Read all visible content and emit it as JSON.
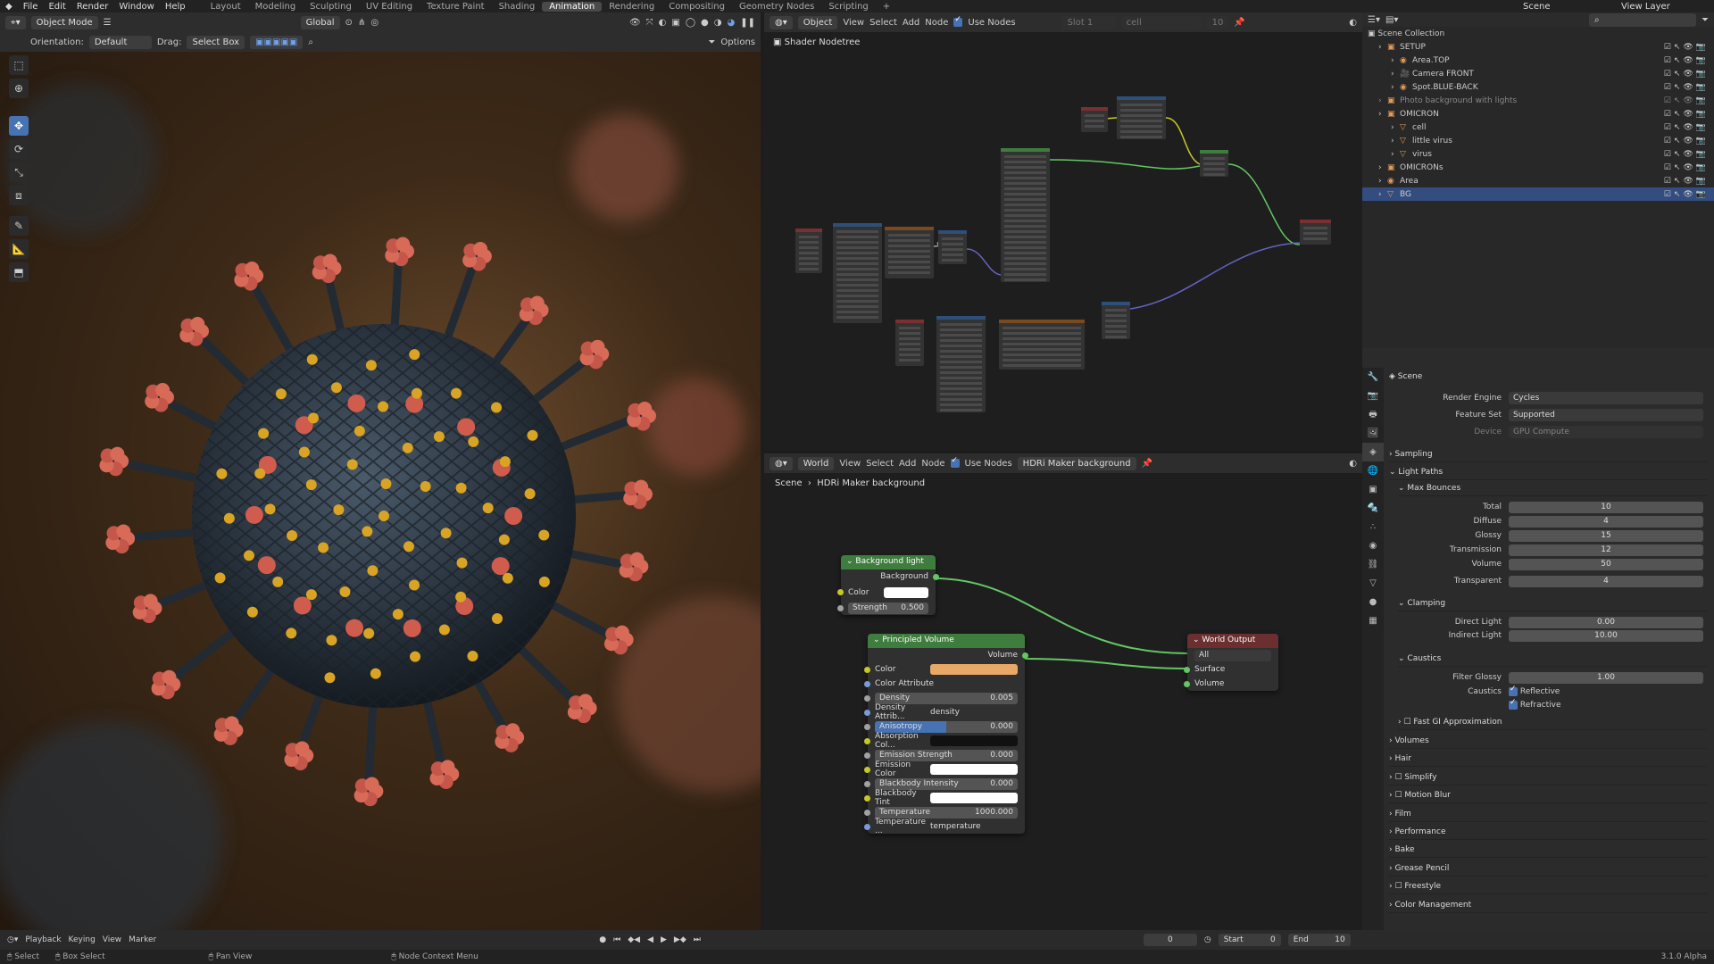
{
  "topbar": {
    "menus": [
      "File",
      "Edit",
      "Render",
      "Window",
      "Help"
    ],
    "workspaces": [
      "Layout",
      "Modeling",
      "Sculpting",
      "UV Editing",
      "Texture Paint",
      "Shading",
      "Animation",
      "Rendering",
      "Compositing",
      "Geometry Nodes",
      "Scripting"
    ],
    "active_workspace": "Animation",
    "scene": "Scene",
    "view_layer": "View Layer"
  },
  "viewport": {
    "mode": "Object Mode",
    "orientation_label": "Orientation:",
    "orientation": "Default",
    "drag_label": "Drag:",
    "drag": "Select Box",
    "transform": "Global",
    "options": "Options"
  },
  "shader_editor": {
    "type": "Object",
    "menus": [
      "View",
      "Select",
      "Add",
      "Node"
    ],
    "use_nodes": "Use Nodes",
    "slot": "Slot 1",
    "material": "cell",
    "users": "10",
    "tree_label": "Shader Nodetree"
  },
  "world_editor": {
    "type": "World",
    "menus": [
      "View",
      "Select",
      "Add",
      "Node"
    ],
    "use_nodes": "Use Nodes",
    "world_name": "HDRi Maker background",
    "breadcrumb_scene": "Scene",
    "breadcrumb_world": "HDRi Maker background",
    "background_node": {
      "title": "Background light",
      "output": "Background",
      "color": "Color",
      "strength_label": "Strength",
      "strength": "0.500"
    },
    "volume_node": {
      "title": "Principled Volume",
      "output": "Volume",
      "rows": [
        {
          "label": "Color",
          "value": ""
        },
        {
          "label": "Color Attribute",
          "value": ""
        },
        {
          "label": "Density",
          "value": "0.005"
        },
        {
          "label": "Density Attrib...",
          "value": "density"
        },
        {
          "label": "Anisotropy",
          "value": "0.000"
        },
        {
          "label": "Absorption Col...",
          "value": ""
        },
        {
          "label": "Emission Strength",
          "value": "0.000"
        },
        {
          "label": "Emission Color",
          "value": ""
        },
        {
          "label": "Blackbody Intensity",
          "value": "0.000"
        },
        {
          "label": "Blackbody Tint",
          "value": ""
        },
        {
          "label": "Temperature",
          "value": "1000.000"
        },
        {
          "label": "Temperature ...",
          "value": "temperature"
        }
      ]
    },
    "output_node": {
      "title": "World Output",
      "target": "All",
      "surface": "Surface",
      "volume": "Volume"
    }
  },
  "outliner": {
    "root": "Scene Collection",
    "items": [
      {
        "name": "SETUP",
        "level": 0
      },
      {
        "name": "Area.TOP",
        "level": 1
      },
      {
        "name": "Camera FRONT",
        "level": 1
      },
      {
        "name": "Spot.BLUE-BACK",
        "level": 1
      },
      {
        "name": "Photo background with lights",
        "level": 0
      },
      {
        "name": "OMICRON",
        "level": 0
      },
      {
        "name": "cell",
        "level": 1
      },
      {
        "name": "little virus",
        "level": 1
      },
      {
        "name": "virus",
        "level": 1
      },
      {
        "name": "OMICRONs",
        "level": 0
      },
      {
        "name": "Area",
        "level": 0
      },
      {
        "name": "BG",
        "level": 0
      }
    ]
  },
  "properties": {
    "scene": "Scene",
    "render_engine_label": "Render Engine",
    "render_engine": "Cycles",
    "feature_set_label": "Feature Set",
    "feature_set": "Supported",
    "device_label": "Device",
    "device": "GPU Compute",
    "sampling": "Sampling",
    "light_paths": "Light Paths",
    "max_bounces": "Max Bounces",
    "bounces": [
      {
        "label": "Total",
        "value": "10"
      },
      {
        "label": "Diffuse",
        "value": "4"
      },
      {
        "label": "Glossy",
        "value": "15"
      },
      {
        "label": "Transmission",
        "value": "12"
      },
      {
        "label": "Volume",
        "value": "50"
      },
      {
        "label": "Transparent",
        "value": "4"
      }
    ],
    "clamping": "Clamping",
    "direct_light_label": "Direct Light",
    "direct_light": "0.00",
    "indirect_light_label": "Indirect Light",
    "indirect_light": "10.00",
    "caustics": "Caustics",
    "filter_glossy_label": "Filter Glossy",
    "filter_glossy": "1.00",
    "caustics_label": "Caustics",
    "reflective": "Reflective",
    "refractive": "Refractive",
    "fast_gi": "Fast GI Approximation",
    "panels": [
      "Volumes",
      "Hair",
      "Simplify",
      "Motion Blur",
      "Film",
      "Performance",
      "Bake",
      "Grease Pencil",
      "Freestyle",
      "Color Management"
    ]
  },
  "timeline": {
    "playback": "Playback",
    "keying": "Keying",
    "view": "View",
    "marker": "Marker",
    "current": "0",
    "start_label": "Start",
    "start": "0",
    "end_label": "End",
    "end": "10"
  },
  "status": {
    "select": "Select",
    "box_select": "Box Select",
    "pan_view": "Pan View",
    "context": "Node Context Menu",
    "version": "3.1.0 Alpha"
  }
}
